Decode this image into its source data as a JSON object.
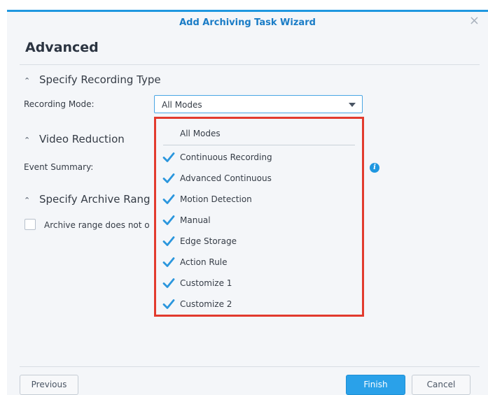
{
  "dialog": {
    "title": "Add Archiving Task Wizard",
    "close_glyph": "×",
    "heading": "Advanced"
  },
  "sections": {
    "recording_type": {
      "chevron": "^",
      "label": "Specify Recording Type"
    },
    "video_reduction": {
      "chevron": "^",
      "label": "Video Reduction"
    },
    "archive_range": {
      "chevron": "^",
      "label": "Specify Archive Rang"
    }
  },
  "fields": {
    "recording_mode_label": "Recording Mode:",
    "recording_mode_value": "All Modes",
    "event_summary_label": "Event Summary:",
    "info_glyph": "i",
    "archive_range_checkbox_label": "Archive range does not o",
    "archive_range_checked": false
  },
  "dropdown": {
    "header": "All Modes",
    "items": [
      {
        "label": "Continuous Recording",
        "checked": true
      },
      {
        "label": "Advanced Continuous",
        "checked": true
      },
      {
        "label": "Motion Detection",
        "checked": true
      },
      {
        "label": "Manual",
        "checked": true
      },
      {
        "label": "Edge Storage",
        "checked": true
      },
      {
        "label": "Action Rule",
        "checked": true
      },
      {
        "label": "Customize 1",
        "checked": true
      },
      {
        "label": "Customize 2",
        "checked": true
      }
    ]
  },
  "buttons": {
    "previous": "Previous",
    "finish": "Finish",
    "cancel": "Cancel"
  },
  "colors": {
    "accent": "#1f97e0",
    "highlight_border": "#e23b2e",
    "checkmark": "#2a96dd"
  }
}
